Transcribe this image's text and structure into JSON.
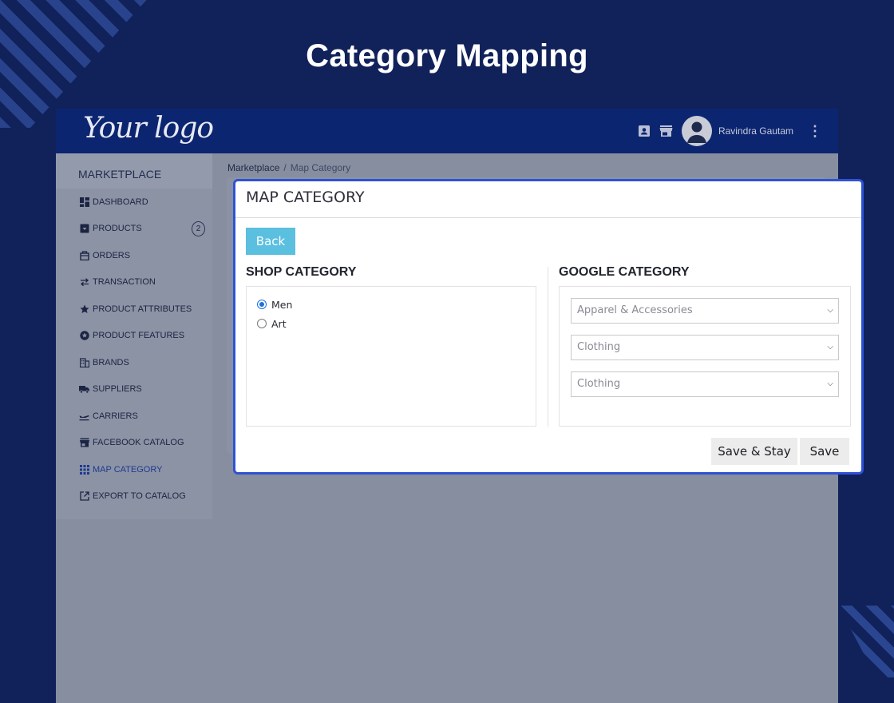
{
  "page_heading": "Category Mapping",
  "header": {
    "logo_text": "Your logo",
    "user_name": "Ravindra Gautam"
  },
  "sidebar": {
    "title": "MARKETPLACE",
    "items": [
      {
        "label": "DASHBOARD",
        "icon": "dashboard-icon"
      },
      {
        "label": "PRODUCTS",
        "icon": "archive-icon",
        "badge": "2"
      },
      {
        "label": "ORDERS",
        "icon": "basket-icon"
      },
      {
        "label": "TRANSACTION",
        "icon": "swap-icon"
      },
      {
        "label": "PRODUCT ATTRIBUTES",
        "icon": "star-icon"
      },
      {
        "label": "PRODUCT FEATURES",
        "icon": "feature-star-icon"
      },
      {
        "label": "BRANDS",
        "icon": "building-icon"
      },
      {
        "label": "SUPPLIERS",
        "icon": "truck-icon"
      },
      {
        "label": "CARRIERS",
        "icon": "plane-icon"
      },
      {
        "label": "FACEBOOK CATALOG",
        "icon": "store-icon"
      },
      {
        "label": "MAP CATEGORY",
        "icon": "grid-icon"
      },
      {
        "label": "EXPORT TO CATALOG",
        "icon": "export-icon"
      }
    ]
  },
  "breadcrumb": {
    "root": "Marketplace",
    "separator": "/",
    "current": "Map Category"
  },
  "modal": {
    "title": "MAP CATEGORY",
    "back_label": "Back",
    "shop_title": "SHOP CATEGORY",
    "shop_options": [
      {
        "label": "Men",
        "checked": true
      },
      {
        "label": "Art",
        "checked": false
      }
    ],
    "google_title": "GOOGLE CATEGORY",
    "selects": [
      "Apparel & Accessories",
      "Clothing",
      "Clothing"
    ],
    "save_stay_label": "Save & Stay",
    "save_label": "Save"
  },
  "colors": {
    "background": "#11215a",
    "topbar": "#0c2570",
    "modal_border": "#2e52d6",
    "back_button": "#5bbfe0"
  }
}
